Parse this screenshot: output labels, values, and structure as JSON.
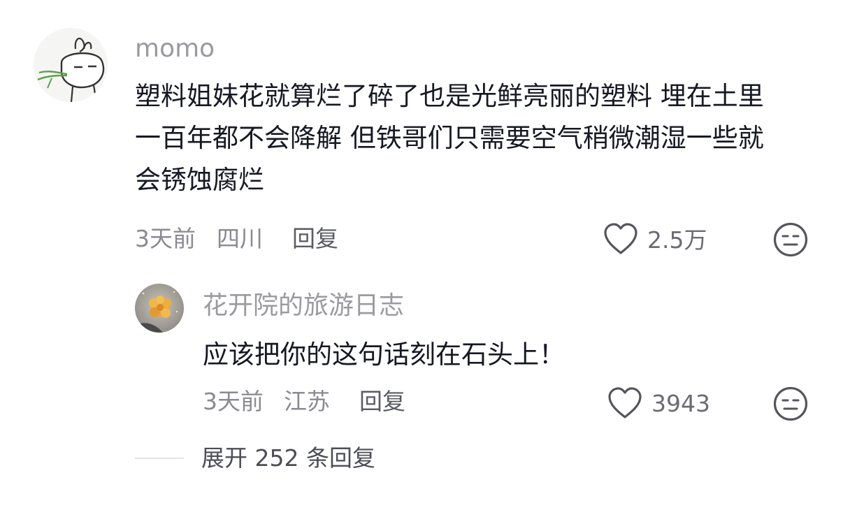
{
  "comment": {
    "username": "momo",
    "text": "塑料姐妹花就算烂了碎了也是光鲜亮丽的塑料 埋在土里一百年都不会降解 但铁哥们只需要空气稍微潮湿一些就会锈蚀腐烂",
    "time": "3天前",
    "location": "四川",
    "reply_label": "回复",
    "likes": "2.5万",
    "avatar_icon": "cartoon-bunny-avatar",
    "like_icon": "heart-outline-icon",
    "react_icon": "meh-face-icon"
  },
  "reply": {
    "username": "花开院的旅游日志",
    "text": "应该把你的这句话刻在石头上！",
    "time": "3天前",
    "location": "江苏",
    "reply_label": "回复",
    "likes": "3943",
    "avatar_icon": "orange-flower-avatar",
    "like_icon": "heart-outline-icon",
    "react_icon": "meh-face-icon"
  },
  "expand": {
    "label": "展开 252 条回复"
  },
  "colors": {
    "username": "#9a9a9f",
    "text": "#161823",
    "meta": "#8a8b91",
    "icon": "#55565c"
  }
}
